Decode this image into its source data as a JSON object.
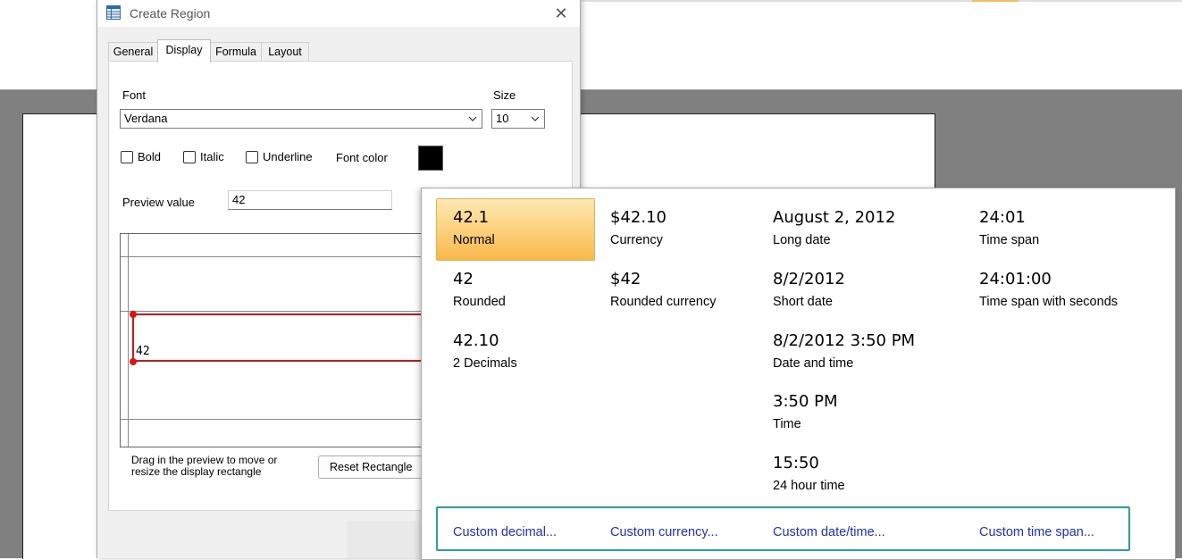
{
  "dialog": {
    "title": "Create Region",
    "close_glyph": "✕",
    "tabs": [
      {
        "label": "General",
        "active": false
      },
      {
        "label": "Display",
        "active": true
      },
      {
        "label": "Formula",
        "active": false
      },
      {
        "label": "Layout",
        "active": false
      }
    ],
    "font_label": "Font",
    "font_value": "Verdana",
    "size_label": "Size",
    "size_value": "10",
    "checkboxes": {
      "bold": {
        "label": "Bold",
        "checked": false
      },
      "italic": {
        "label": "Italic",
        "checked": false
      },
      "underline": {
        "label": "Underline",
        "checked": false
      }
    },
    "font_color_label": "Font color",
    "font_color": "#000000",
    "preview_value_label": "Preview value",
    "preview_value": "42",
    "preview_text": "42",
    "hint_line1": "Drag in the preview to move or",
    "hint_line2": "resize the display rectangle",
    "reset_button": "Reset Rectangle"
  },
  "formats": {
    "normal": {
      "value": "42.1",
      "name": "Normal",
      "selected": true
    },
    "currency": {
      "value": "$42.10",
      "name": "Currency"
    },
    "long_date": {
      "value": "August 2, 2012",
      "name": "Long date"
    },
    "time_span": {
      "value": "24:01",
      "name": "Time span"
    },
    "rounded": {
      "value": "42",
      "name": "Rounded"
    },
    "rounded_currency": {
      "value": "$42",
      "name": "Rounded currency"
    },
    "short_date": {
      "value": "8/2/2012",
      "name": "Short date"
    },
    "time_span_seconds": {
      "value": "24:01:00",
      "name": "Time span with seconds"
    },
    "two_decimals": {
      "value": "42.10",
      "name": "2 Decimals"
    },
    "date_time": {
      "value": "8/2/2012 3:50 PM",
      "name": "Date and time"
    },
    "time": {
      "value": "3:50 PM",
      "name": "Time"
    },
    "hour24": {
      "value": "15:50",
      "name": "24 hour time"
    }
  },
  "custom_links": {
    "decimal": "Custom decimal...",
    "currency": "Custom currency...",
    "datetime": "Custom date/time...",
    "timespan": "Custom time span..."
  },
  "colors": {
    "selection_red": "#e01010",
    "highlight_box": "#2aa0a4",
    "link": "#1a2fd6",
    "selected_format_fill": "#fbcf77"
  }
}
